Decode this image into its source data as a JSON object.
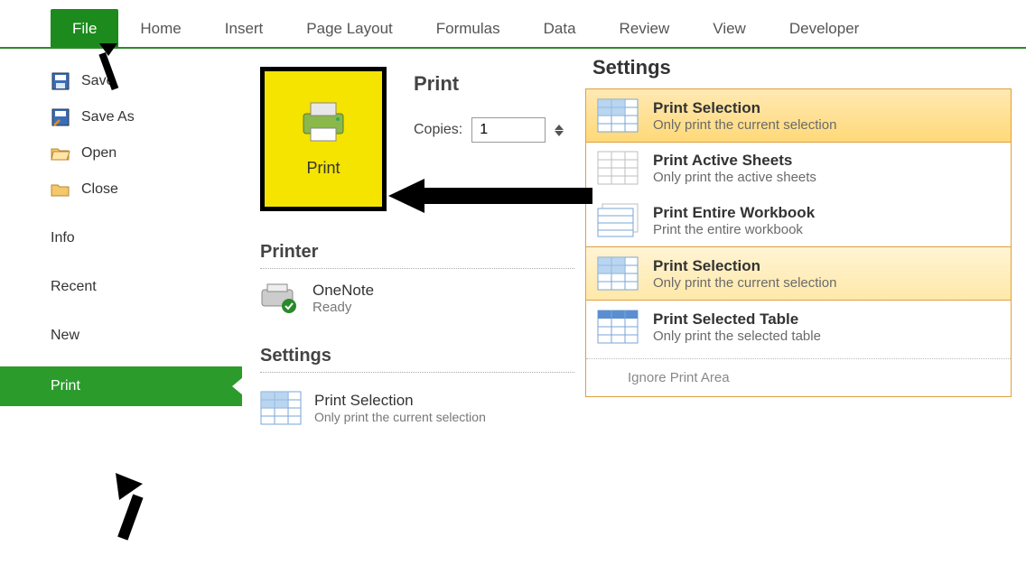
{
  "ribbon": {
    "tabs": [
      "File",
      "Home",
      "Insert",
      "Page Layout",
      "Formulas",
      "Data",
      "Review",
      "View",
      "Developer"
    ],
    "active_index": 0
  },
  "backstage": {
    "save": "Save",
    "save_as": "Save As",
    "open": "Open",
    "close": "Close",
    "info": "Info",
    "recent": "Recent",
    "new": "New",
    "print": "Print"
  },
  "center": {
    "print_heading": "Print",
    "print_button_label": "Print",
    "copies_label": "Copies:",
    "copies_value": "1",
    "printer_heading": "Printer",
    "printer_name": "OneNote",
    "printer_status": "Ready",
    "settings_heading": "Settings",
    "settings_option_title": "Print Selection",
    "settings_option_sub": "Only print the current selection"
  },
  "right": {
    "heading": "Settings",
    "options": [
      {
        "title": "Print Selection",
        "sub": "Only print the current selection"
      },
      {
        "title": "Print Active Sheets",
        "sub": "Only print the active sheets"
      },
      {
        "title": "Print Entire Workbook",
        "sub": "Print the entire workbook"
      },
      {
        "title": "Print Selection",
        "sub": "Only print the current selection"
      },
      {
        "title": "Print Selected Table",
        "sub": "Only print the selected table"
      }
    ],
    "ignore": "Ignore Print Area"
  }
}
